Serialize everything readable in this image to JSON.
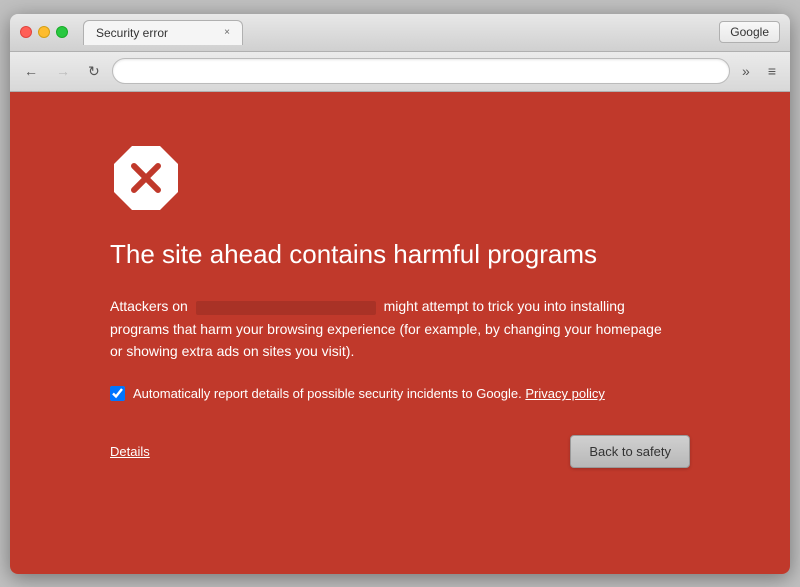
{
  "browser": {
    "tab_title": "Security error",
    "tab_close_label": "×",
    "google_button_label": "Google",
    "address_bar_value": "",
    "address_bar_placeholder": ""
  },
  "nav": {
    "back_label": "←",
    "forward_label": "→",
    "reload_label": "↻",
    "menu_dots_label": "»",
    "menu_lines_label": "≡"
  },
  "error_page": {
    "icon_label": "✕",
    "title": "The site ahead contains harmful programs",
    "description_before": "Attackers on",
    "description_after": "might attempt to trick you into installing programs that harm your browsing experience (for example, by changing your homepage or showing extra ads on sites you visit).",
    "checkbox_label": "Automatically report details of possible security incidents to Google.",
    "privacy_link_label": "Privacy policy",
    "details_link_label": "Details",
    "back_button_label": "Back to safety"
  },
  "colors": {
    "page_background": "#c0392b",
    "icon_fill": "#c0392b",
    "icon_stroke": "white",
    "back_button_bg": "#c8c8c8"
  }
}
